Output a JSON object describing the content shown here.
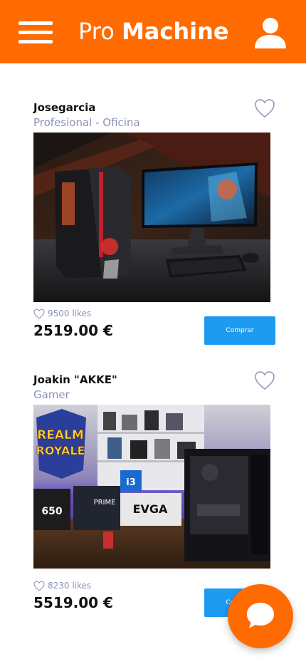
{
  "header": {
    "brand_light": "Pro",
    "brand_bold": "Machine",
    "menu_icon": "hamburger-menu-icon",
    "user_icon": "user-icon"
  },
  "posts": [
    {
      "author": "Josegarcia",
      "category": "Profesional - Oficina",
      "likes": "9500 likes",
      "price": "2519.00 €",
      "buy_label": "Comprar",
      "image_desc_icon": "gaming-pc-photo"
    },
    {
      "author": "Joakin \"AKKE\"",
      "category": "Gamer",
      "likes": "8230 likes",
      "price": "5519.00 €",
      "buy_label": "Comprar",
      "image_desc_icon": "pc-components-photo",
      "image_text": {
        "logo_line1": "REALM",
        "logo_line2": "ROYALE",
        "cpu_box": "i3",
        "board_box": "PRIME",
        "gpu_box": "EVGA",
        "psu_box": "650"
      }
    }
  ],
  "colors": {
    "brand_orange": "#ff6b00",
    "button_blue": "#1e9bf0",
    "muted_text": "#8a93b8"
  },
  "fab": {
    "icon": "chat-bubble-icon"
  }
}
